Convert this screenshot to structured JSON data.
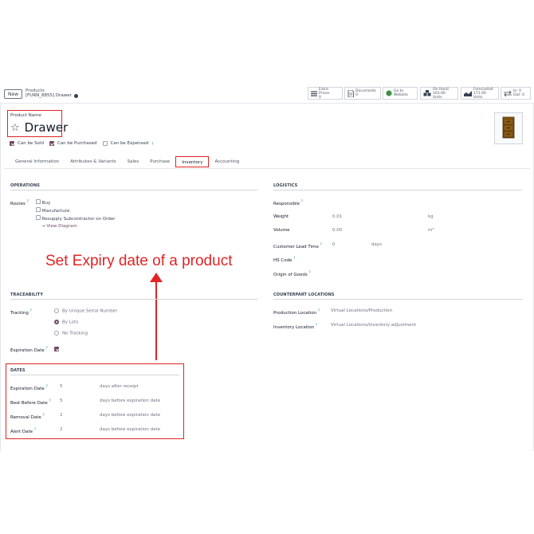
{
  "header": {
    "new_label": "New",
    "breadcrumb_parent": "Products",
    "breadcrumb_current": "[FURN_8855] Drawer"
  },
  "smart_buttons": [
    {
      "icon": "list-icon",
      "line1": "Extra Prices",
      "line2": "0"
    },
    {
      "icon": "document-icon",
      "line1": "Documents",
      "line2": "0"
    },
    {
      "icon": "globe-icon",
      "line1": "Go to",
      "line2": "Website"
    },
    {
      "icon": "boxes-icon",
      "line1": "On Hand",
      "line2": "163.00 Units"
    },
    {
      "icon": "chart-icon",
      "line1": "Forecasted",
      "line2": "171.00 Units"
    },
    {
      "icon": "arrows-icon",
      "line1": "In: 0",
      "line2": "Out: 0"
    }
  ],
  "product": {
    "name_label": "Product Name",
    "name": "Drawer",
    "can_be_sold": "Can be Sold",
    "can_be_purchased": "Can be Purchased",
    "can_be_expensed": "Can be Expensed",
    "help_mark": "?"
  },
  "tabs": [
    "General Information",
    "Attributes & Variants",
    "Sales",
    "Purchase",
    "Inventory",
    "Accounting"
  ],
  "operations": {
    "title": "OPERATIONS",
    "routes_label": "Routes",
    "routes": [
      "Buy",
      "Manufacture",
      "Resupply Subcontractor on Order"
    ],
    "view_diagram": "→ View Diagram"
  },
  "logistics": {
    "title": "LOGISTICS",
    "responsible": "Responsible",
    "weight_label": "Weight",
    "weight_value": "0.01",
    "weight_unit": "kg",
    "volume_label": "Volume",
    "volume_value": "0.00",
    "volume_unit": "m³",
    "lead_label": "Customer Lead Time",
    "lead_value": "0",
    "lead_unit": "days",
    "hs_code": "HS Code",
    "origin": "Origin of Goods"
  },
  "annotation": "Set Expiry date of a product",
  "traceability": {
    "title": "TRACEABILITY",
    "tracking_label": "Tracking",
    "options": [
      "By Unique Serial Number",
      "By Lots",
      "No Tracking"
    ],
    "expiration_label": "Expiration Date"
  },
  "counterpart": {
    "title": "COUNTERPART LOCATIONS",
    "production_label": "Production Location",
    "production_value": "Virtual Locations/Production",
    "inventory_label": "Inventory Location",
    "inventory_value": "Virtual Locations/Inventory adjustment"
  },
  "dates": {
    "title": "DATES",
    "rows": [
      {
        "label": "Expiration Date",
        "value": "5",
        "desc": "days after receipt"
      },
      {
        "label": "Best Before Date",
        "value": "5",
        "desc": "days before expiration date"
      },
      {
        "label": "Removal Date",
        "value": "2",
        "desc": "days before expiration date"
      },
      {
        "label": "Alert Date",
        "value": "2",
        "desc": "days before expiration date"
      }
    ]
  },
  "colors": {
    "accent": "#714b67",
    "annotation": "#e02424",
    "help": "#017e84"
  }
}
